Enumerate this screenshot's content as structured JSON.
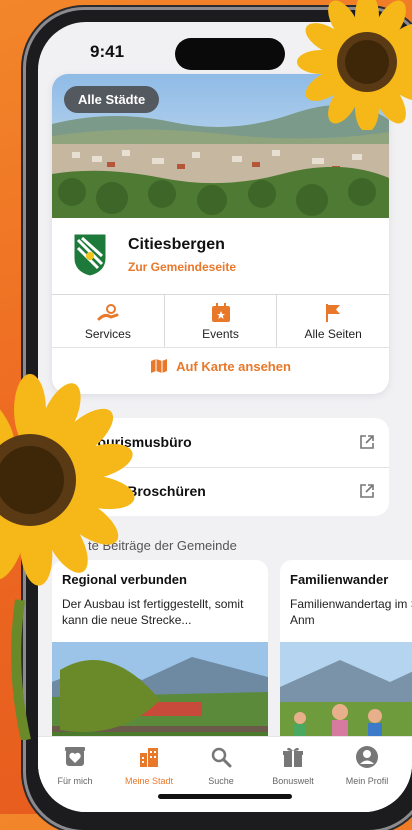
{
  "status": {
    "time": "9:41"
  },
  "hero": {
    "badge": "Alle Städte"
  },
  "city": {
    "name": "Citiesbergen",
    "link": "Zur Gemeindeseite"
  },
  "tiles": [
    {
      "label": "Services",
      "icon": "gear-hands-icon"
    },
    {
      "label": "Events",
      "icon": "calendar-icon"
    },
    {
      "label": "Alle Seiten",
      "icon": "flag-icon"
    }
  ],
  "map": {
    "label": "Auf Karte ansehen",
    "icon": "map-icon"
  },
  "links": [
    {
      "label": "Tourismusbüro"
    },
    {
      "label": "o-Broschüren"
    }
  ],
  "section": {
    "title": "te Beiträge der Gemeinde"
  },
  "news": [
    {
      "title": "Regional verbunden",
      "desc": "Der Ausbau ist fertiggestellt, somit kann die neue Strecke..."
    },
    {
      "title": "Familienwander",
      "desc": "Familienwandertag im September! Anm"
    }
  ],
  "tabbar": [
    {
      "label": "Für mich",
      "icon": "heart-box-icon"
    },
    {
      "label": "Meine Stadt",
      "icon": "city-icon"
    },
    {
      "label": "Suche",
      "icon": "search-icon"
    },
    {
      "label": "Bonuswelt",
      "icon": "gift-icon"
    },
    {
      "label": "Mein Profil",
      "icon": "profile-icon"
    }
  ],
  "colors": {
    "accent": "#e8782a",
    "background": "#ee6b22"
  }
}
